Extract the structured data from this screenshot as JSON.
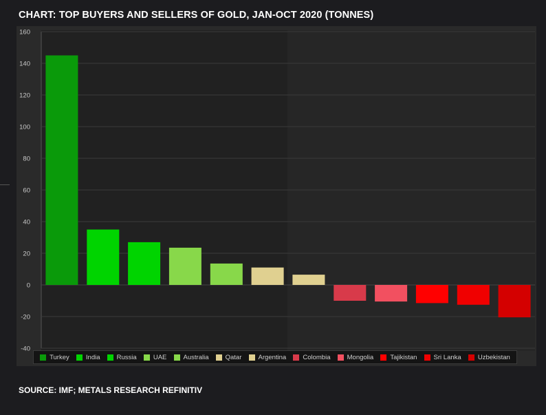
{
  "header": {
    "title": "CHART: TOP BUYERS AND SELLERS OF GOLD, JAN-OCT 2020 (TONNES)"
  },
  "footer": {
    "source": "SOURCE: IMF; METALS RESEARCH REFINITIV"
  },
  "chart_data": {
    "type": "bar",
    "title": "CHART: TOP BUYERS AND SELLERS OF GOLD, JAN-OCT 2020 (TONNES)",
    "xlabel": "",
    "ylabel": "",
    "ylim": [
      -40,
      160
    ],
    "yticks": [
      160,
      140,
      120,
      100,
      80,
      60,
      40,
      20,
      0,
      -20,
      -40
    ],
    "grid": true,
    "legend": "bottom",
    "categories": [
      "Turkey",
      "India",
      "Russia",
      "UAE",
      "Australia",
      "Qatar",
      "Argentina",
      "Colombia",
      "Mongolia",
      "Tajikistan",
      "Sri Lanka",
      "Uzbekistan"
    ],
    "values": [
      145,
      35,
      27,
      23.5,
      13.5,
      11,
      6.5,
      -10,
      -10.5,
      -11.5,
      -12.5,
      -20.5
    ],
    "colors": [
      "#0a9a0a",
      "#00d400",
      "#00d400",
      "#88d84a",
      "#88d84a",
      "#e0d090",
      "#e0d090",
      "#d83a4a",
      "#f25060",
      "#ff0000",
      "#f00000",
      "#d40000"
    ]
  }
}
